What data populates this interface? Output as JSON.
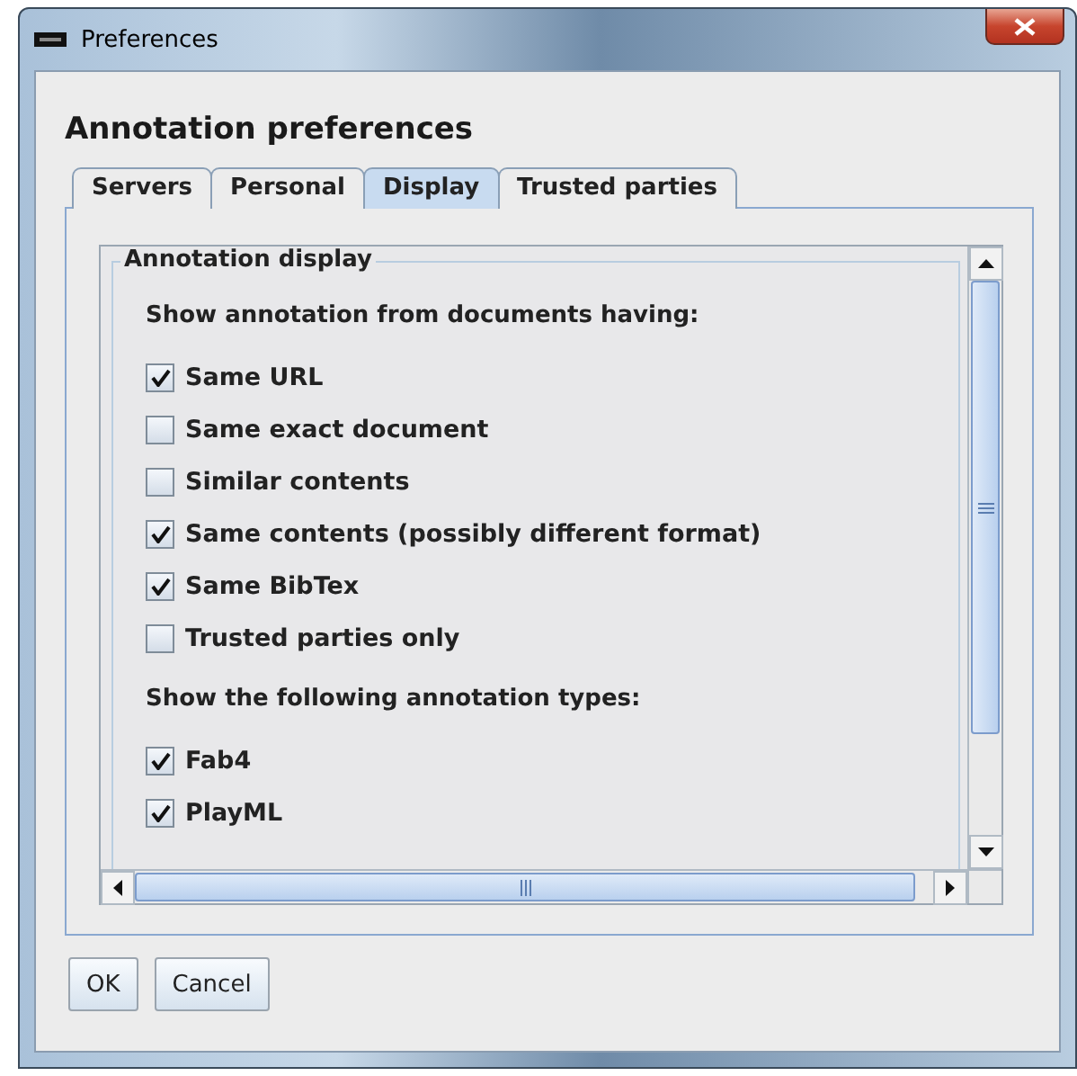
{
  "window": {
    "title": "Preferences"
  },
  "heading": "Annotation preferences",
  "tabs": [
    {
      "label": "Servers",
      "selected": false
    },
    {
      "label": "Personal",
      "selected": false
    },
    {
      "label": "Display",
      "selected": true
    },
    {
      "label": "Trusted parties",
      "selected": false
    }
  ],
  "group": {
    "title": "Annotation display",
    "sections": [
      {
        "label": "Show annotation from documents having:",
        "options": [
          {
            "label": "Same URL",
            "checked": true
          },
          {
            "label": "Same exact document",
            "checked": false
          },
          {
            "label": "Similar contents",
            "checked": false
          },
          {
            "label": "Same contents (possibly different format)",
            "checked": true
          },
          {
            "label": "Same BibTex",
            "checked": true
          },
          {
            "label": "Trusted parties only",
            "checked": false
          }
        ]
      },
      {
        "label": "Show the following annotation types:",
        "options": [
          {
            "label": "Fab4",
            "checked": true
          },
          {
            "label": "PlayML",
            "checked": true
          }
        ]
      }
    ]
  },
  "buttons": [
    "OK",
    "Cancel"
  ]
}
